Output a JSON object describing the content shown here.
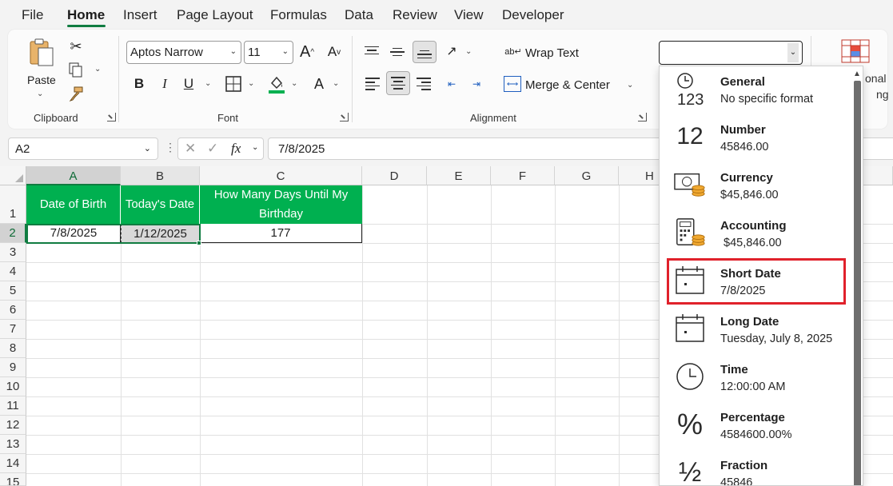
{
  "menu": {
    "tabs": [
      "File",
      "Home",
      "Insert",
      "Page Layout",
      "Formulas",
      "Data",
      "Review",
      "View",
      "Developer"
    ],
    "active": "Home"
  },
  "ribbon": {
    "clipboard": {
      "paste_label": "Paste",
      "group_label": "Clipboard"
    },
    "font": {
      "font_name": "Aptos Narrow",
      "font_size": "11",
      "bold": "B",
      "italic": "I",
      "underline": "U",
      "font_color_glyph": "A",
      "grow": "A",
      "shrink": "A",
      "group_label": "Font"
    },
    "alignment": {
      "wrap_text": "Wrap Text",
      "merge_center": "Merge & Center",
      "group_label": "Alignment"
    },
    "number": {
      "format_value": ""
    },
    "styles_peek": {
      "line1": "onal",
      "line2": "ng"
    }
  },
  "formula_bar": {
    "name_box": "A2",
    "fx": "fx",
    "formula": "7/8/2025"
  },
  "grid": {
    "columns": [
      "A",
      "B",
      "C",
      "D",
      "E",
      "F",
      "G",
      "H"
    ],
    "rows": [
      "1",
      "2",
      "3",
      "4",
      "5",
      "6",
      "7",
      "8",
      "9",
      "10",
      "11",
      "12",
      "13",
      "14",
      "15"
    ],
    "headers": [
      "Date of Birth",
      "Today's Date",
      "How Many Days Until My Birthday"
    ],
    "values": [
      "7/8/2025",
      "1/12/2025",
      "177"
    ]
  },
  "number_format_menu": {
    "items": [
      {
        "title": "General",
        "sample": "No specific format",
        "icon": "clock-123-icon"
      },
      {
        "title": "Number",
        "sample": "45846.00",
        "icon": "number-12-icon"
      },
      {
        "title": "Currency",
        "sample": "$45,846.00",
        "icon": "currency-icon"
      },
      {
        "title": "Accounting",
        "sample": " $45,846.00",
        "icon": "calculator-icon"
      },
      {
        "title": "Short Date",
        "sample": "7/8/2025",
        "icon": "calendar-icon"
      },
      {
        "title": "Long Date",
        "sample": "Tuesday, July 8, 2025",
        "icon": "calendar-icon"
      },
      {
        "title": "Time",
        "sample": "12:00:00 AM",
        "icon": "clock-icon"
      },
      {
        "title": "Percentage",
        "sample": "4584600.00%",
        "icon": "percent-icon"
      },
      {
        "title": "Fraction",
        "sample": "45846",
        "icon": "fraction-icon"
      }
    ],
    "highlighted": "Short Date",
    "highlight_color": "#e0212b"
  },
  "colors": {
    "accent": "#107c41",
    "header_fill": "#00b050"
  }
}
